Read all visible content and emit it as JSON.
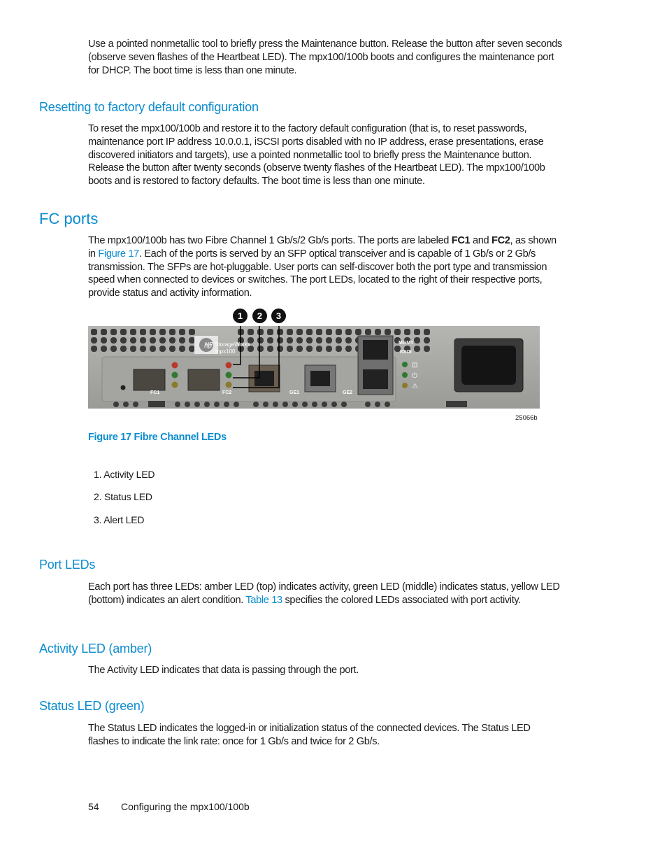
{
  "intro_paragraph": "Use a pointed nonmetallic tool to briefly press the Maintenance button. Release the button after seven seconds (observe seven flashes of the Heartbeat LED). The mpx100/100b boots and configures the maintenance port for DHCP. The boot time is less than one minute.",
  "sections": {
    "reset": {
      "heading": "Resetting to factory default configuration",
      "body": "To reset the mpx100/100b and restore it to the factory default configuration (that is, to reset passwords, maintenance port IP address 10.0.0.1, iSCSI ports disabled with no IP address, erase presentations, erase discovered initiators and targets), use a pointed nonmetallic tool to briefly press the Maintenance button. Release the button after twenty seconds (observe twenty flashes of the Heartbeat LED). The mpx100/100b boots and is restored to factory defaults. The boot time is less than one minute."
    },
    "fc_ports": {
      "heading": "FC ports",
      "body_part1": "The mpx100/100b has two Fibre Channel 1 Gb/s/2 Gb/s ports. The ports are labeled ",
      "bold1": "FC1",
      "body_part2": " and ",
      "bold2": "FC2",
      "body_part3": ", as shown in ",
      "link": "Figure 17",
      "body_part4": ". Each of the ports is served by an SFP optical transceiver and is capable of 1 Gb/s or 2 Gb/s transmission. The SFPs are hot-pluggable. User ports can self-discover both the port type and transmission speed when connected to devices or switches. The port LEDs, located to the right of their respective ports, provide status and activity information."
    },
    "figure": {
      "callouts": [
        "1",
        "2",
        "3"
      ],
      "labels": {
        "brand": "HP StorageWorks",
        "model": "mpx100",
        "fc1": "FC1",
        "fc2": "FC2",
        "ge1": "GE1",
        "ge2": "GE2",
        "mgmt": "MGMT",
        "ioioi": "IOIOI"
      },
      "id": "25066b",
      "caption": "Figure 17 Fibre Channel LEDs",
      "list": [
        "1. Activity LED",
        "2. Status LED",
        "3. Alert LED"
      ]
    },
    "port_leds": {
      "heading": "Port LEDs",
      "body_part1": "Each port has three LEDs: amber LED (top) indicates activity, green LED (middle) indicates status, yellow LED (bottom) indicates an alert condition. ",
      "link": "Table 13",
      "body_part2": " specifies the colored LEDs associated with port activity."
    },
    "activity_led": {
      "heading": "Activity LED (amber)",
      "body": "The Activity LED indicates that data is passing through the port."
    },
    "status_led": {
      "heading": "Status LED (green)",
      "body": "The Status LED indicates the logged-in or initialization status of the connected devices. The Status LED flashes to indicate the link rate: once for 1 Gb/s and twice for 2 Gb/s."
    }
  },
  "footer": {
    "page_number": "54",
    "chapter": "Configuring the mpx100/100b"
  },
  "colors": {
    "heading": "#0a8ccf",
    "led_amber": "#b83a2c",
    "led_green": "#2f7a2f",
    "led_yellow": "#8a7a2a"
  }
}
